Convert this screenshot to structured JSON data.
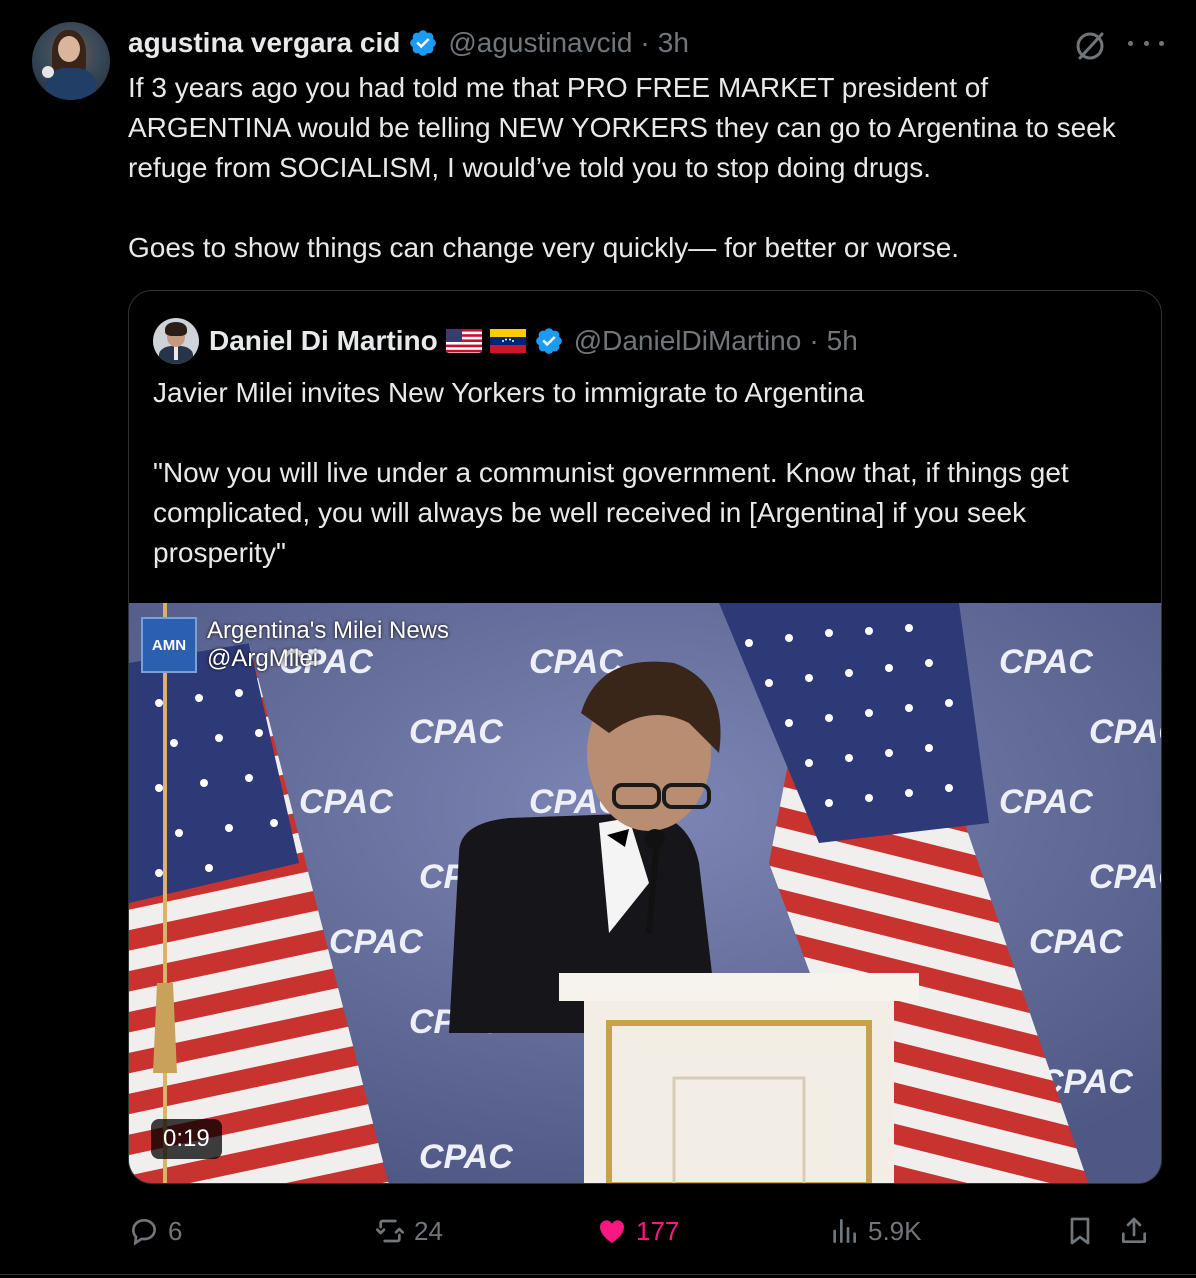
{
  "tweet": {
    "author_name": "agustina vergara cid",
    "author_handle": "@agustinavcid",
    "separator": "·",
    "time": "3h",
    "text_paragraph_1": "If 3 years ago you had told me that PRO FREE MARKET president of ARGENTINA would be telling NEW YORKERS they can go to Argentina to seek refuge from SOCIALISM, I would’ve told you to stop doing drugs.",
    "text_paragraph_2": "Goes to show things can change very quickly— for better or worse.",
    "verified_icon": "verified-badge-icon",
    "grok_icon": "grok-icon",
    "more_icon": "more-icon"
  },
  "quoted": {
    "author_name": "Daniel Di Martino",
    "flags": [
      "us-flag-icon",
      "venezuela-flag-icon"
    ],
    "author_handle": "@DanielDiMartino",
    "separator": "·",
    "time": "5h",
    "text_paragraph_1": "Javier Milei invites New Yorkers to immigrate to Argentina",
    "text_paragraph_2": "\"Now you will live under a communist government. Know that, if things get complicated, you will always be well received in [Argentina] if you seek prosperity\"",
    "video": {
      "watermark_logo": "AMN",
      "watermark_line_1": "Argentina's Milei News",
      "watermark_line_2": "@ArgMilei",
      "backdrop_text": "CPAC",
      "duration": "0:19"
    }
  },
  "actions": {
    "replies": "6",
    "reposts": "24",
    "likes": "177",
    "views": "5.9K",
    "like_color": "#f91880",
    "muted_color": "#71767b",
    "icons": [
      "reply-icon",
      "repost-icon",
      "like-icon",
      "views-icon",
      "bookmark-icon",
      "share-icon"
    ]
  },
  "colors": {
    "background": "#000000",
    "text": "#e7e9ea",
    "secondary": "#71767b",
    "verified": "#1d9bf0",
    "border": "#2f3336"
  }
}
